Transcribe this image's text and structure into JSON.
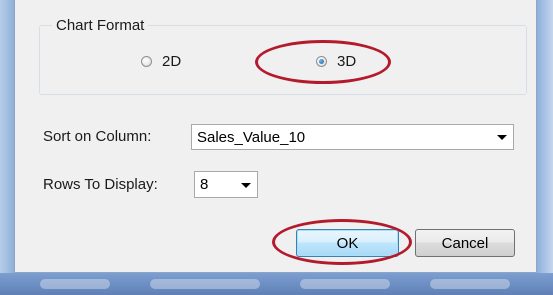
{
  "chart_format": {
    "title": "Chart Format",
    "options": [
      {
        "label": "2D",
        "checked": false
      },
      {
        "label": "3D",
        "checked": true
      }
    ]
  },
  "sort": {
    "label": "Sort on Column:",
    "value": "Sales_Value_10"
  },
  "rows": {
    "label": "Rows To Display:",
    "value": "8"
  },
  "buttons": {
    "ok": "OK",
    "cancel": "Cancel"
  },
  "colors": {
    "highlight": "#b31b2c",
    "dialog_bg": "#f0f0f0",
    "default_button_border": "#3c7fb1"
  },
  "icons": [
    "radio-unchecked-icon",
    "radio-checked-icon",
    "chevron-down-icon"
  ]
}
